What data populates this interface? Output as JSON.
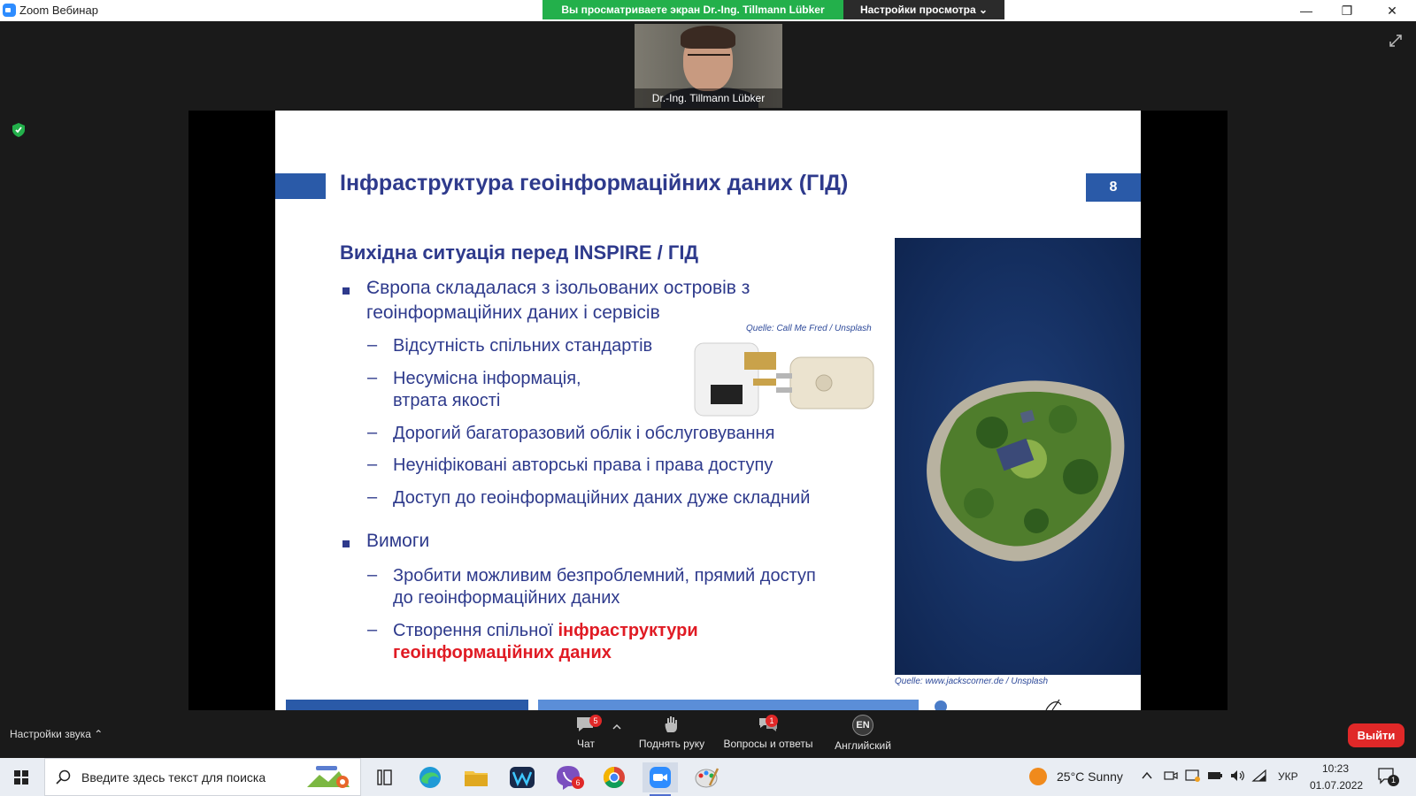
{
  "titlebar": {
    "app_title": "Zoom Вебинар",
    "share_banner": "Вы просматриваете экран Dr.-Ing. Tillmann Lübker",
    "view_options": "Настройки просмотра ⌄",
    "minimize": "—",
    "restore": "❐",
    "close": "✕"
  },
  "participant": {
    "name": "Dr.-Ing. Tillmann Lübker"
  },
  "slide": {
    "title": "Інфраструктура геоінформаційних даних (ГІД)",
    "page_number": "8",
    "subtitle": "Вихідна ситуація перед INSPIRE / ГІД",
    "bullet1_line1": "Європа складалася з ізольованих островів з",
    "bullet1_line2": "геоінформаційних даних і сервісів",
    "sub1": "Відсутність спільних стандартів",
    "sub2_line1": "Несумісна інформація,",
    "sub2_line2": "втрата якості",
    "sub3": "Дорогий багаторазовий облік і обслуговування",
    "sub4": "Неуніфіковані авторські права і права доступу",
    "sub5": "Доступ до геоінформаційних даних дуже складний",
    "bullet2": "Вимоги",
    "sub6_line1": "Зробити можливим безпроблемний, прямий доступ",
    "sub6_line2": "до геоінформаційних даних",
    "sub7_prefix": "Створення спільної ",
    "sub7_red1": "інфраструктури",
    "sub7_red2": "геоінформаційних даних",
    "credit_plug": "Quelle: Call Me Fred / Unsplash",
    "credit_island": "Quelle: www.jackscorner.de / Unsplash"
  },
  "controls": {
    "audio_settings": "Настройки звука  ⌃",
    "chat_label": "Чат",
    "chat_badge": "5",
    "raise_hand_label": "Поднять руку",
    "qa_label": "Вопросы и ответы",
    "qa_badge": "1",
    "language_label": "Английский",
    "language_code": "EN",
    "leave_label": "Выйти"
  },
  "taskbar": {
    "search_placeholder": "Введите здесь текст для поиска",
    "viber_badge": "6",
    "weather": "25°C  Sunny",
    "keyboard_lang": "УКР",
    "time": "10:23",
    "date": "01.07.2022",
    "notifications_count": "1"
  },
  "colors": {
    "slide_blue": "#2e3a8c",
    "accent_blue": "#2a5aa8",
    "red": "#e01b24",
    "banner_green": "#23b04b"
  }
}
